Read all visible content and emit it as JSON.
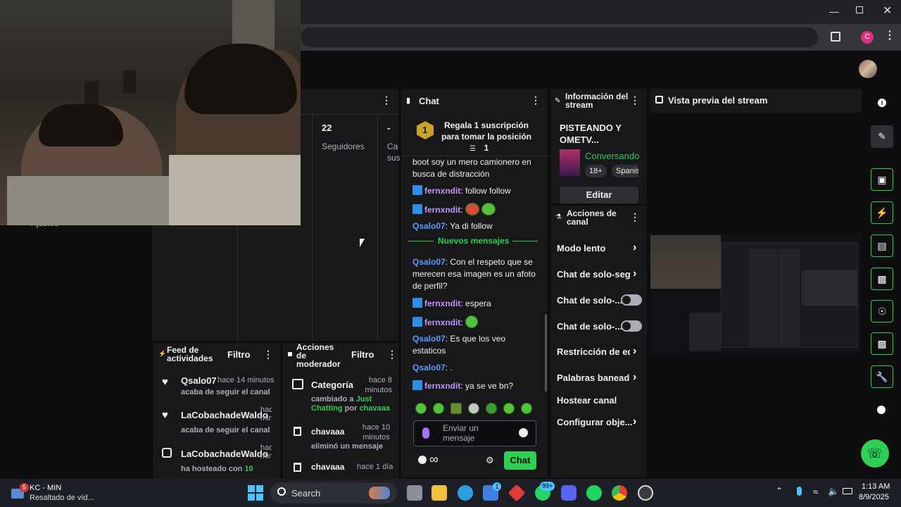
{
  "browser": {
    "profile_initial": "C"
  },
  "stats": {
    "followers_count": "22",
    "followers_label": "Seguidores",
    "dash": "-",
    "cut_label": "Ca",
    "cut_label2": "sus"
  },
  "settings_label": "Ajustes",
  "chat": {
    "title": "Chat",
    "pinned_rank": "1",
    "pinned_text": "Regala 1 suscripción para tomar la posición 1",
    "messages": [
      {
        "user": "",
        "text": "boot soy un mero camionero en busca de distracción"
      },
      {
        "user": "fernxndit",
        "text": "follow follow"
      },
      {
        "user": "fernxndit",
        "text": ""
      },
      {
        "user": "Qsalo07",
        "text": "Ya di follow"
      }
    ],
    "new_messages_label": "Nuevos mensajes",
    "messages2": [
      {
        "user": "Qsalo07",
        "text": "Con el respeto que se merecen esa imagen es un afoto de perfil?"
      },
      {
        "user": "fernxndit",
        "text": "espera"
      },
      {
        "user": "fernxndit",
        "text": ""
      },
      {
        "user": "Qsalo07",
        "text": "Es que los veo estaticos"
      },
      {
        "user": "Qsalo07",
        "text": "."
      },
      {
        "user": "fernxndit",
        "text": "ya se ve bn?"
      }
    ],
    "input_placeholder": "Enviar un mensaje",
    "infinity": "∞",
    "send_label": "Chat"
  },
  "stream_info": {
    "title": "Información del stream",
    "stream_title": "PISTEANDO Y OMETV...",
    "category": "Conversando",
    "tag1": "18+",
    "tag2": "Spanis",
    "edit_label": "Editar"
  },
  "channel_actions": {
    "title": "Acciones de canal",
    "items": [
      {
        "label": "Modo lento",
        "kind": "chevron"
      },
      {
        "label": "Chat de solo-segu",
        "kind": "chevron"
      },
      {
        "label": "Chat de solo-...",
        "kind": "toggle"
      },
      {
        "label": "Chat de solo-...",
        "kind": "toggle"
      },
      {
        "label": "Restricción de eda",
        "kind": "chevron"
      },
      {
        "label": "Palabras baneada",
        "kind": "chevron"
      },
      {
        "label": "Hostear canal",
        "kind": "none"
      },
      {
        "label": "Configurar obje...",
        "kind": "chevron"
      }
    ]
  },
  "preview": {
    "title": "Vista previa del stream"
  },
  "activity_feed": {
    "title": "Feed de actividades",
    "filter_label": "Filtro",
    "items": [
      {
        "user": "Qsalo07",
        "time": "hace 14 minutos",
        "desc": "acaba de seguir el canal"
      },
      {
        "user": "LaCobachadeWaldo",
        "time": "hace min",
        "desc": "acaba de seguir el canal"
      },
      {
        "user": "LaCobachadeWaldo",
        "time": "hace min",
        "desc_prefix": "ha hosteado con",
        "desc_num": "10"
      }
    ]
  },
  "mod_actions": {
    "title": "Acciones de moderador",
    "filter_label": "Filtro",
    "items": [
      {
        "title": "Categoría",
        "time": "hace 8 minutos",
        "desc_prefix": "cambiado a",
        "category": "Just Chatting",
        "by": "por",
        "user": "chavaaa"
      },
      {
        "title": "chavaaa",
        "time": "hace 10 minutos",
        "desc": "eliminó un mensaje"
      },
      {
        "title": "chavaaa",
        "time": "hace 1 día"
      }
    ]
  },
  "taskbar": {
    "app_title": "KC - MIN",
    "app_subtitle": "Resaltado de víd...",
    "app_badge": "5",
    "search_label": "Search",
    "store_badge": "1",
    "whatsapp_badge": "99+",
    "time": "1:13 AM",
    "date": "8/9/2025"
  },
  "colors": {
    "accent": "#2fce55",
    "bg": "#0e0e10",
    "panel": "#18181b",
    "purple": "#bf94ff",
    "blue": "#5c9cff"
  }
}
